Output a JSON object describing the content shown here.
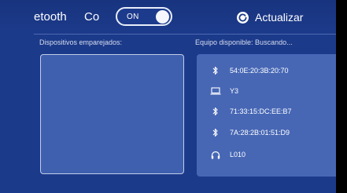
{
  "header": {
    "bluetooth_label": "etooth",
    "connect_label": "Co",
    "toggle_state": "ON",
    "refresh_label": "Actualizar"
  },
  "paired": {
    "title": "Dispositivos emparejados:"
  },
  "available": {
    "title": "Equipo disponible: Buscando...",
    "devices": [
      {
        "name": "54:0E:20:3B:20:70",
        "icon": "bluetooth-icon"
      },
      {
        "name": "Y3",
        "icon": "laptop-icon"
      },
      {
        "name": "71:33:15:DC:EE:B7",
        "icon": "bluetooth-icon"
      },
      {
        "name": "7A:28:2B:01:51:D9",
        "icon": "bluetooth-icon"
      },
      {
        "name": "L010",
        "icon": "headphones-icon"
      }
    ]
  },
  "colors": {
    "background": "#1c3a8a",
    "panel": "#4767b5",
    "paired_box": "#3f60ae",
    "text": "#ffffff"
  }
}
